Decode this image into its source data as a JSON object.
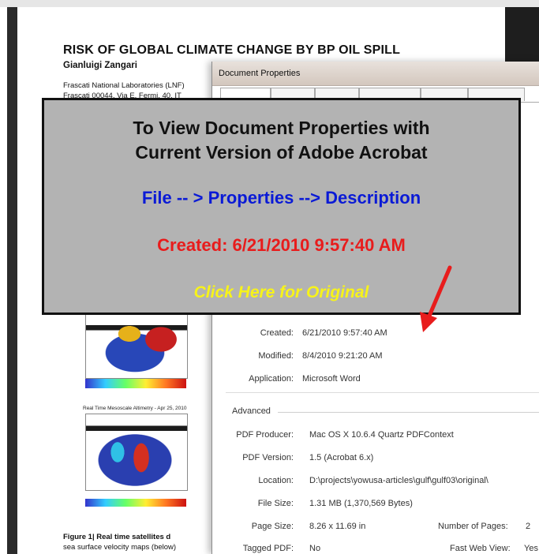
{
  "document": {
    "title": "RISK OF GLOBAL CLIMATE CHANGE BY BP OIL SPILL",
    "author": "Gianluigi Zangari",
    "affiliation": "Frascati National Laboratories (LNF)",
    "address": "Frascati 00044, Via E. Fermi, 40, IT",
    "figure2_title": "Real Time Mesoscale Altimetry - Apr 25, 2010",
    "figure_caption_bold": "Figure 1| Real time satellites d",
    "figure_caption_text": "sea surface velocity maps (below)"
  },
  "dialog": {
    "title": "Document Properties",
    "properties": [
      {
        "label": "Created:",
        "value": "6/21/2010 9:57:40 AM"
      },
      {
        "label": "Modified:",
        "value": "8/4/2010 9:21:20 AM"
      },
      {
        "label": "Application:",
        "value": "Microsoft Word"
      }
    ],
    "advanced_title": "Advanced",
    "advanced": [
      {
        "label": "PDF Producer:",
        "value": "Mac OS X 10.6.4 Quartz PDFContext"
      },
      {
        "label": "PDF Version:",
        "value": "1.5 (Acrobat 6.x)"
      },
      {
        "label": "Location:",
        "value": "D:\\projects\\yowusa-articles\\gulf\\gulf03\\original\\"
      },
      {
        "label": "File Size:",
        "value": "1.31 MB (1,370,569 Bytes)"
      },
      {
        "label": "Page Size:",
        "value": "8.26 x 11.69 in"
      },
      {
        "label": "Tagged PDF:",
        "value": "No"
      }
    ],
    "page_count_label": "Number of Pages:",
    "page_count_value": "2",
    "fast_web_label": "Fast Web View:",
    "fast_web_value": "Yes"
  },
  "banner": {
    "title_line1": "To View Document Properties with",
    "title_line2": "Current Version of Adobe Acrobat",
    "path": "File -- > Properties --> Description",
    "created": "Created: 6/21/2010 9:57:40 AM",
    "link": "Click Here for Original",
    "colors": {
      "path": "#0a1ad6",
      "created": "#e81c1c",
      "link": "#f7f31a",
      "arrow": "#e81c1c"
    }
  }
}
